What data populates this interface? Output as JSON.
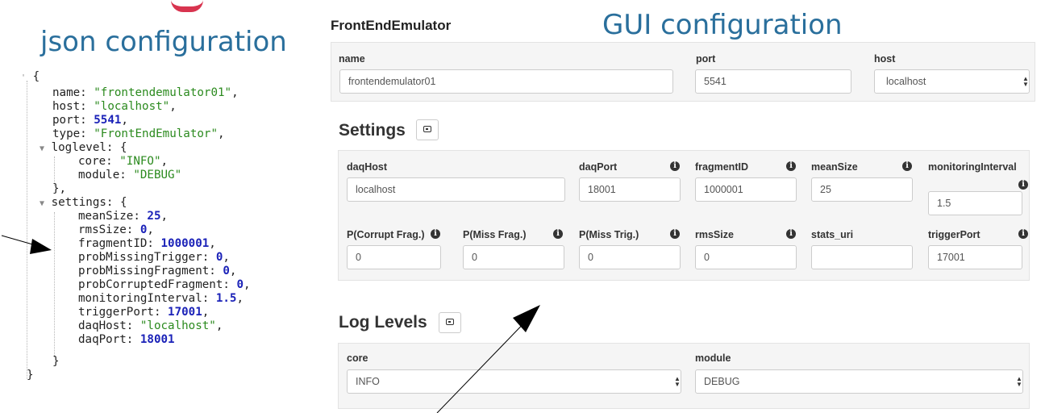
{
  "titles": {
    "json": "json configuration",
    "gui": "GUI configuration"
  },
  "json_lines": [
    "{",
    "name: \"frontendemulator01\",",
    "host: \"localhost\",",
    "port: 5541,",
    "type: \"FrontEndEmulator\",",
    "loglevel: {",
    "core: \"INFO\",",
    "module: \"DEBUG\"",
    "},",
    "settings: {",
    "meanSize: 25,",
    "rmsSize: 0,",
    "fragmentID: 1000001,",
    "probMissingTrigger: 0,",
    "probMissingFragment: 0,",
    "probCorruptedFragment: 0,",
    "monitoringInterval: 1.5,",
    "triggerPort: 17001,",
    "daqHost: \"localhost\",",
    "daqPort: 18001",
    "}",
    "}"
  ],
  "panel": {
    "heading": "FrontEndEmulator",
    "name_label": "name",
    "name_value": "frontendemulator01",
    "port_label": "port",
    "port_value": "5541",
    "host_label": "host",
    "host_value": "localhost"
  },
  "settings": {
    "title": "Settings",
    "fields": [
      {
        "label": "daqHost",
        "value": "localhost",
        "info": false
      },
      {
        "label": "daqPort",
        "value": "18001",
        "info": true
      },
      {
        "label": "fragmentID",
        "value": "1000001",
        "info": true
      },
      {
        "label": "meanSize",
        "value": "25",
        "info": true
      },
      {
        "label": "monitoringInterval",
        "value": "1.5",
        "info": true
      },
      {
        "label": "P(Corrupt Frag.)",
        "value": "0",
        "info": true
      },
      {
        "label": "P(Miss Frag.)",
        "value": "0",
        "info": true
      },
      {
        "label": "P(Miss Trig.)",
        "value": "0",
        "info": true
      },
      {
        "label": "rmsSize",
        "value": "0",
        "info": true
      },
      {
        "label": "stats_uri",
        "value": "",
        "info": false
      },
      {
        "label": "triggerPort",
        "value": "17001",
        "info": true
      }
    ]
  },
  "log_levels": {
    "title": "Log Levels",
    "core_label": "core",
    "core_value": "INFO",
    "module_label": "module",
    "module_value": "DEBUG"
  },
  "icons": {
    "info": "info-circle-icon",
    "collapse": "collapse-icon",
    "select": "select-caret-icon"
  },
  "colors": {
    "title": "#2a6f9c",
    "json_string": "#2b8a1e",
    "json_number": "#1b22b8",
    "panel_background": "#f5f5f5"
  }
}
